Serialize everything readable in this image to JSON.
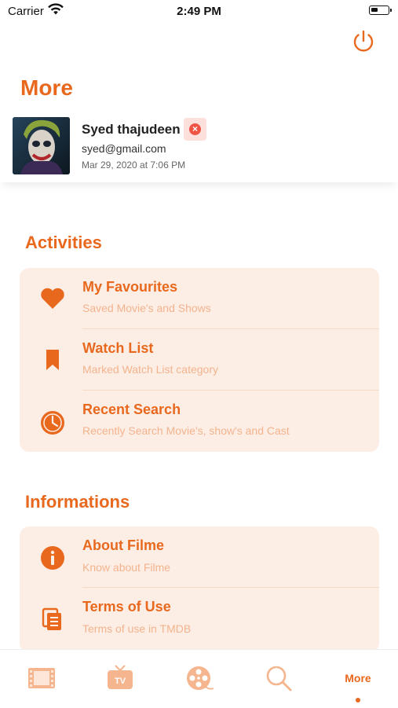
{
  "status_bar": {
    "carrier": "Carrier",
    "time": "2:49 PM"
  },
  "header": {
    "title": "More"
  },
  "profile": {
    "name": "Syed thajudeen",
    "email": "syed@gmail.com",
    "date": "Mar 29, 2020 at 7:06 PM"
  },
  "activities": {
    "heading": "Activities",
    "items": [
      {
        "title": "My Favourites",
        "subtitle": "Saved Movie's and Shows",
        "icon": "heart-icon"
      },
      {
        "title": "Watch List",
        "subtitle": "Marked Watch List category",
        "icon": "bookmark-icon"
      },
      {
        "title": "Recent Search",
        "subtitle": "Recently Search Movie's, show's and Cast",
        "icon": "clock-icon"
      }
    ]
  },
  "informations": {
    "heading": "Informations",
    "items": [
      {
        "title": "About Filme",
        "subtitle": "Know about Filme",
        "icon": "info-icon"
      },
      {
        "title": "Terms of Use",
        "subtitle": "Terms of use in TMDB",
        "icon": "document-icon"
      }
    ]
  },
  "tab_bar": {
    "tabs": [
      {
        "icon": "film-strip-icon"
      },
      {
        "icon": "tv-icon"
      },
      {
        "icon": "film-reel-icon"
      },
      {
        "icon": "search-icon"
      },
      {
        "label": "More"
      }
    ],
    "active": "More"
  },
  "colors": {
    "accent": "#e8681e",
    "card_bg": "#fdeee5",
    "subtitle": "#f3b38e",
    "tab_inactive": "#f5b58e"
  }
}
